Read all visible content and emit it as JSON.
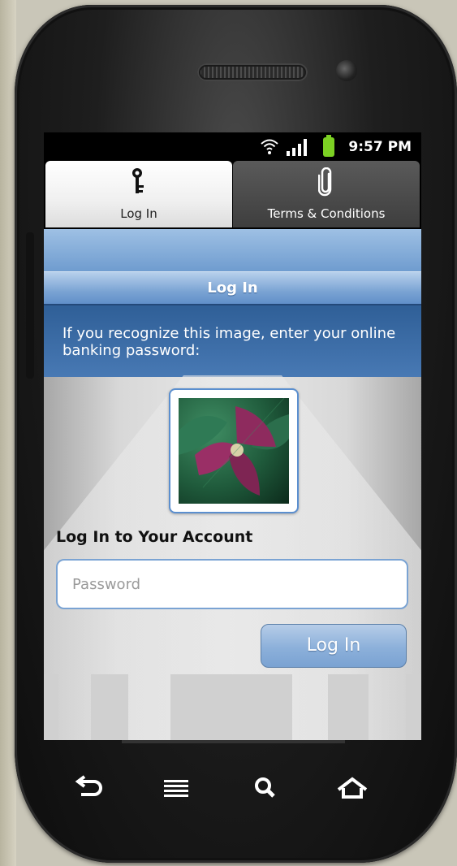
{
  "status_bar": {
    "time": "9:57 PM",
    "icons": [
      "wifi-icon",
      "signal-icon",
      "battery-icon"
    ]
  },
  "tabs": [
    {
      "label": "Log In",
      "icon": "key-icon",
      "active": true
    },
    {
      "label": "Terms & Conditions",
      "icon": "paperclip-icon",
      "active": false
    }
  ],
  "header": {
    "title": "Log In"
  },
  "info": {
    "text": "If you recognize this image, enter your online banking password:"
  },
  "login_form": {
    "heading": "Log In to Your Account",
    "password_placeholder": "Password",
    "submit_label": "Log In"
  },
  "nav_bar": {
    "buttons": [
      "back-icon",
      "menu-icon",
      "search-icon",
      "home-icon"
    ]
  },
  "colors": {
    "accent_blue": "#4879b4",
    "title_blue": "#7aa3d3",
    "battery_green": "#7cd123"
  }
}
